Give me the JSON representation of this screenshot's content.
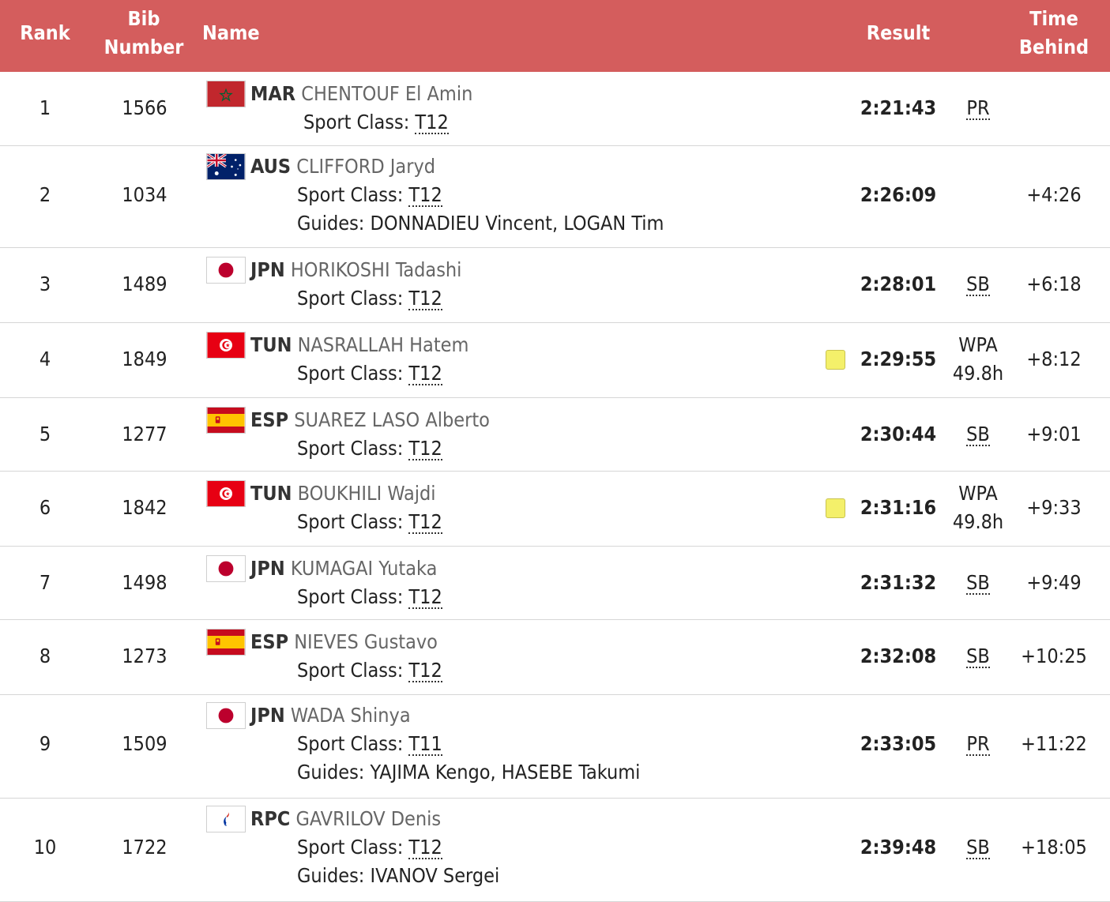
{
  "colors": {
    "header_bg": "#d45d5d",
    "header_text": "#ffffff",
    "yellow_card": "#f4f06a"
  },
  "headers": {
    "rank": "Rank",
    "bib_line1": "Bib",
    "bib_line2": "Number",
    "name": "Name",
    "result": "Result",
    "behind_line1": "Time",
    "behind_line2": "Behind"
  },
  "sport_class_label": "Sport Class: ",
  "guides_label": "Guides: ",
  "rows": [
    {
      "rank": "1",
      "bib": "1566",
      "flag_icon": "morocco-flag-icon",
      "noc": "MAR",
      "name": "CHENTOUF El Amin",
      "sport_class": "T12",
      "guides": "",
      "yellow_card": false,
      "result": "2:21:43",
      "note": "PR",
      "note2": "",
      "behind": ""
    },
    {
      "rank": "2",
      "bib": "1034",
      "flag_icon": "australia-flag-icon",
      "noc": "AUS",
      "name": "CLIFFORD Jaryd",
      "sport_class": "T12",
      "guides": "DONNADIEU Vincent, LOGAN Tim",
      "yellow_card": false,
      "result": "2:26:09",
      "note": "",
      "note2": "",
      "behind": "+4:26"
    },
    {
      "rank": "3",
      "bib": "1489",
      "flag_icon": "japan-flag-icon",
      "noc": "JPN",
      "name": "HORIKOSHI Tadashi",
      "sport_class": "T12",
      "guides": "",
      "yellow_card": false,
      "result": "2:28:01",
      "note": "SB",
      "note2": "",
      "behind": "+6:18"
    },
    {
      "rank": "4",
      "bib": "1849",
      "flag_icon": "tunisia-flag-icon",
      "noc": "TUN",
      "name": "NASRALLAH Hatem",
      "sport_class": "T12",
      "guides": "",
      "yellow_card": true,
      "result": "2:29:55",
      "note": "WPA",
      "note2": "49.8h",
      "behind": "+8:12"
    },
    {
      "rank": "5",
      "bib": "1277",
      "flag_icon": "spain-flag-icon",
      "noc": "ESP",
      "name": "SUAREZ LASO Alberto",
      "sport_class": "T12",
      "guides": "",
      "yellow_card": false,
      "result": "2:30:44",
      "note": "SB",
      "note2": "",
      "behind": "+9:01"
    },
    {
      "rank": "6",
      "bib": "1842",
      "flag_icon": "tunisia-flag-icon",
      "noc": "TUN",
      "name": "BOUKHILI Wajdi",
      "sport_class": "T12",
      "guides": "",
      "yellow_card": true,
      "result": "2:31:16",
      "note": "WPA",
      "note2": "49.8h",
      "behind": "+9:33"
    },
    {
      "rank": "7",
      "bib": "1498",
      "flag_icon": "japan-flag-icon",
      "noc": "JPN",
      "name": "KUMAGAI Yutaka",
      "sport_class": "T12",
      "guides": "",
      "yellow_card": false,
      "result": "2:31:32",
      "note": "SB",
      "note2": "",
      "behind": "+9:49"
    },
    {
      "rank": "8",
      "bib": "1273",
      "flag_icon": "spain-flag-icon",
      "noc": "ESP",
      "name": "NIEVES Gustavo",
      "sport_class": "T12",
      "guides": "",
      "yellow_card": false,
      "result": "2:32:08",
      "note": "SB",
      "note2": "",
      "behind": "+10:25"
    },
    {
      "rank": "9",
      "bib": "1509",
      "flag_icon": "japan-flag-icon",
      "noc": "JPN",
      "name": "WADA Shinya",
      "sport_class": "T11",
      "guides": "YAJIMA Kengo, HASEBE Takumi",
      "yellow_card": false,
      "result": "2:33:05",
      "note": "PR",
      "note2": "",
      "behind": "+11:22"
    },
    {
      "rank": "10",
      "bib": "1722",
      "flag_icon": "rpc-flag-icon",
      "noc": "RPC",
      "name": "GAVRILOV Denis",
      "sport_class": "T12",
      "guides": "IVANOV Sergei",
      "yellow_card": false,
      "result": "2:39:48",
      "note": "SB",
      "note2": "",
      "behind": "+18:05"
    }
  ]
}
